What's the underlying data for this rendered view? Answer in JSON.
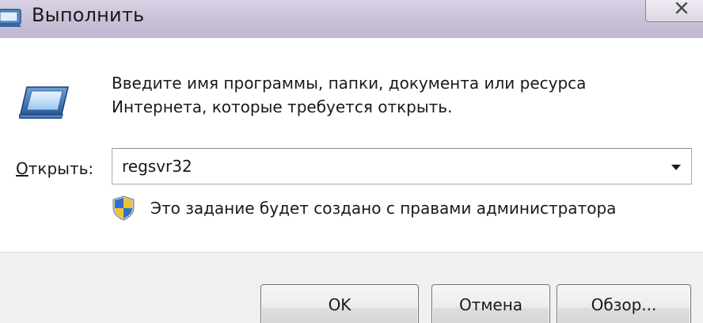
{
  "window": {
    "title": "Выполнить"
  },
  "prompt": {
    "line1": "Введите имя программы, папки, документа или ресурса",
    "line2": "Интернета, которые требуется открыть."
  },
  "open": {
    "label_first": "О",
    "label_rest": "ткрыть:",
    "value": "regsvr32"
  },
  "admin_notice": "Это задание будет создано с правами администратора",
  "buttons": {
    "ok": "OK",
    "cancel": "Отмена",
    "browse": "Обзор..."
  },
  "icons": {
    "title": "run-icon",
    "main": "run-icon",
    "shield": "uac-shield-icon",
    "close": "close-icon",
    "dropdown": "chevron-down-icon"
  }
}
